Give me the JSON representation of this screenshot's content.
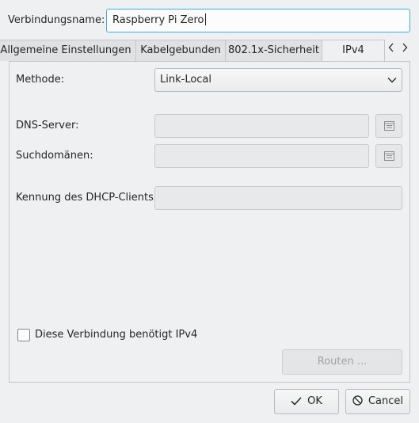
{
  "connection": {
    "name_label": "Verbindungsname:",
    "name_value": "Raspberry Pi Zero"
  },
  "tabs": [
    {
      "label": "Allgemeine Einstellungen"
    },
    {
      "label": "Kabelgebunden"
    },
    {
      "label": "802.1x-Sicherheit"
    },
    {
      "label": "IPv4"
    }
  ],
  "tab_nav": {
    "prev_icon": "chevron-left-icon",
    "next_icon": "chevron-right-icon"
  },
  "ipv4": {
    "method_label": "Methode:",
    "method_value": "Link-Local",
    "dns_label": "DNS-Server:",
    "dns_value": "",
    "search_label": "Suchdomänen:",
    "search_value": "",
    "dhcp_label": "Kennung des DHCP-Clients:",
    "dhcp_value": "",
    "require_ipv4_label": "Diese Verbindung benötigt IPv4",
    "require_ipv4_checked": false,
    "routes_label": "Routen ..."
  },
  "footer": {
    "ok_label": "OK",
    "cancel_label": "Cancel"
  }
}
